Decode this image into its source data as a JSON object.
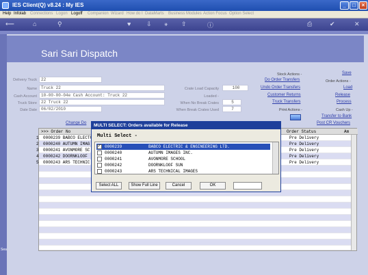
{
  "window": {
    "title": "IES Client(Q) v8.24 : My IES"
  },
  "menu": [
    "Help",
    "Infolab",
    "Connections",
    "Logon",
    "Logoff",
    "Companion",
    "Wizard",
    "How do I",
    "DataMarts",
    "Business Modules",
    "Action Focus",
    "Option Select"
  ],
  "toolbar_icons": [
    "back-icon",
    "home-icon",
    "search-icon",
    "heart-icon",
    "download-icon",
    "share-icon",
    "upload-icon",
    "info-icon",
    "print-icon",
    "check-icon",
    "close-icon"
  ],
  "page": {
    "title": "Sari Sari Dispatch"
  },
  "form": {
    "delivery_truck_label": "Delivery Truck",
    "delivery_truck_value": "22",
    "name_label": "Name",
    "name_value": "Truck 22",
    "cash_account_label": "Cash Account",
    "cash_account_value": "10-00-00-04e Cash Account: Truck 22",
    "truck_store_label": "Truck Store",
    "truck_store_value": "22 Truck 22",
    "date_label": "Date Date",
    "date_value": "06/02/2010",
    "crate_capacity_label": "Crate Load Capacity",
    "crate_capacity_value": "100",
    "loaded_label": "Loaded -",
    "no_break_label": "When No Break Crates",
    "no_break_value": "5",
    "break_label": "When Break Crates Used",
    "break_value": "7",
    "change_link": "Change Do"
  },
  "stock_actions": {
    "heading": "Stock Actions -",
    "links": [
      "Do Order Transfers",
      "Undo Order Transfers",
      "Customer Returns",
      "Truck Transfers"
    ]
  },
  "print_actions": {
    "heading": "Print Actions -"
  },
  "order_actions": {
    "save": "Save",
    "heading": "Order Actions -",
    "links": [
      "Load",
      "Release",
      "Process"
    ]
  },
  "cash_up": {
    "heading": "Cash Up -",
    "links": [
      "Transfer to Bank",
      "Post CR Vouchers"
    ]
  },
  "grid": {
    "col_order": ">>> Order No",
    "col_status": "Order Status",
    "col_am": "Am",
    "rows": [
      {
        "num": "1",
        "order": "0000239 BABCO ELECTR",
        "status": "Pre Delivery"
      },
      {
        "num": "2",
        "order": "0000240 AUTUMN IMAG",
        "status": "Pre Delivery"
      },
      {
        "num": "3",
        "order": "0000241 AVONMORE SC",
        "status": "Pre Delivery"
      },
      {
        "num": "4",
        "order": "0000242 DOORNKLOOF",
        "status": "Pre Delivery"
      },
      {
        "num": "5",
        "order": "0000243 ARS TECHNIC",
        "status": "Pre Delivery"
      }
    ]
  },
  "modal": {
    "title": "MULTI SELECT: Orders available for Release",
    "heading": "Multi Select -",
    "items": [
      {
        "code": "0000239",
        "name": "BABCO ELECTRIC & ENGINEERING LTD.",
        "checked": true
      },
      {
        "code": "0000240",
        "name": "AUTUMN IMAGES INC.",
        "checked": false
      },
      {
        "code": "0000241",
        "name": "AVONMORE SCHOOL",
        "checked": false
      },
      {
        "code": "0000242",
        "name": "DOORNKLOOF SUN",
        "checked": false
      },
      {
        "code": "0000243",
        "name": "ARS TECHNICAL IMAGES",
        "checked": false
      }
    ],
    "buttons": {
      "select_all": "Select ALL",
      "show_full": "Show Full Line",
      "cancel": "Cancel",
      "ok": "OK"
    }
  },
  "left_rail": {
    "label": "Sea"
  }
}
